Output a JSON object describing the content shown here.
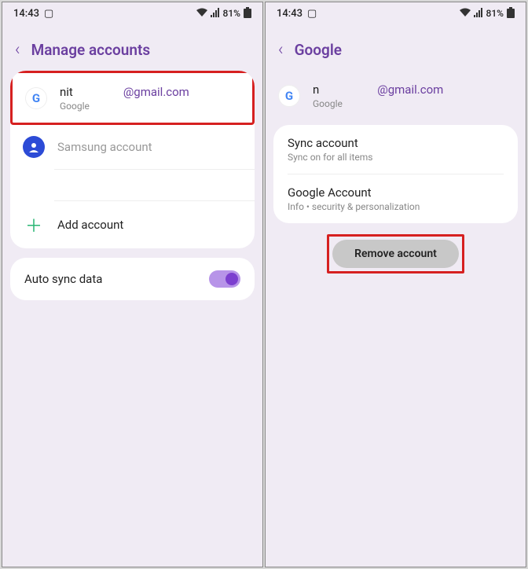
{
  "status": {
    "time": "14:43",
    "battery": "81%"
  },
  "left": {
    "title": "Manage accounts",
    "accounts": [
      {
        "name_part1": "nit",
        "name_part2": "@gmail.com",
        "provider": "Google"
      },
      {
        "name": "Samsung account"
      }
    ],
    "add": "Add account",
    "auto_sync": "Auto sync data"
  },
  "right": {
    "title": "Google",
    "account": {
      "name_part1": "n",
      "name_part2": "@gmail.com",
      "provider": "Google"
    },
    "items": [
      {
        "title": "Sync account",
        "sub": "Sync on for all items"
      },
      {
        "title": "Google Account",
        "sub": "Info • security & personalization"
      }
    ],
    "remove": "Remove account"
  }
}
